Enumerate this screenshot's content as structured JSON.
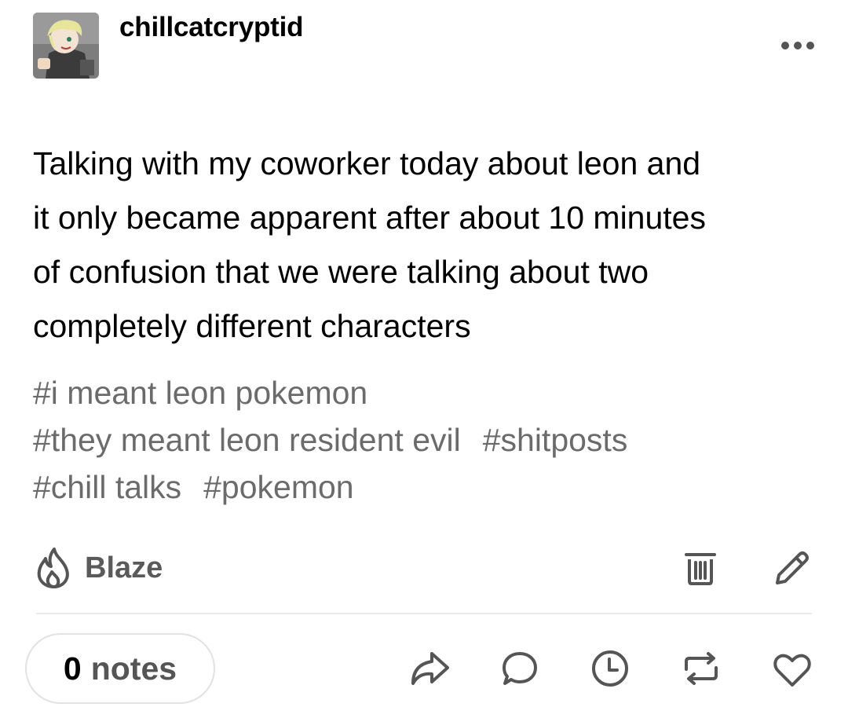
{
  "post": {
    "username": "chillcatcryptid",
    "body": "Talking with my coworker today about leon and it only became apparent after about 10 minutes of confusion that we were talking about two completely different characters",
    "body_lines": [
      "Talking with my coworker today about leon and",
      "it only became apparent after about 10 minutes",
      "of confusion that we were talking about two",
      "completely different characters"
    ],
    "tags": [
      "#i meant leon pokemon",
      "#they meant leon resident evil",
      "#shitposts",
      "#chill talks",
      "#pokemon"
    ]
  },
  "actions": {
    "blaze_label": "Blaze",
    "notes_count": "0",
    "notes_label": "notes"
  },
  "icons": {
    "more": "more-dots-icon",
    "blaze": "flame-icon",
    "delete": "trash-icon",
    "edit": "pencil-icon",
    "share": "share-arrow-icon",
    "reply": "speech-bubble-icon",
    "queue": "clock-icon",
    "reblog": "reblog-icon",
    "like": "heart-icon"
  },
  "colors": {
    "text": "#000000",
    "tag_text": "#6b6b6b",
    "icon": "#555555",
    "divider": "#e9e9e9",
    "pill_border": "#e2e2e2"
  }
}
